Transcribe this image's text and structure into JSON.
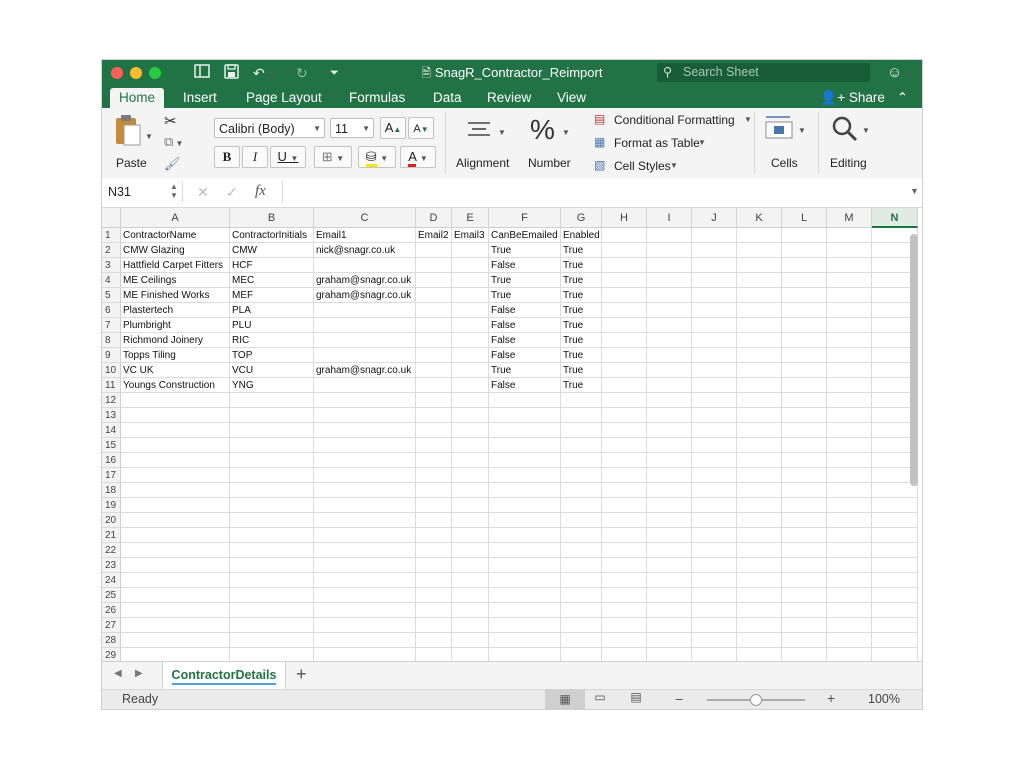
{
  "window": {
    "title": "SnagR_Contractor_Reimport",
    "search_placeholder": "Search Sheet",
    "colors": {
      "accent": "#217346",
      "close": "#fe5f57",
      "minimize": "#febc2e",
      "zoom": "#28c840"
    }
  },
  "ribbon_tabs": [
    "Home",
    "Insert",
    "Page Layout",
    "Formulas",
    "Data",
    "Review",
    "View"
  ],
  "share_label": "Share",
  "ribbon": {
    "paste_label": "Paste",
    "font_name": "Calibri (Body)",
    "font_size": "11",
    "grow_font": "A",
    "shrink_font": "A",
    "bold": "B",
    "italic": "I",
    "underline": "U",
    "font_color_letter": "A",
    "alignment_label": "Alignment",
    "number_symbol": "%",
    "number_label": "Number",
    "conditional_formatting": "Conditional Formatting",
    "format_as_table": "Format as Table",
    "cell_styles": "Cell Styles",
    "cells_label": "Cells",
    "editing_label": "Editing"
  },
  "formula_bar": {
    "name_box": "N31",
    "fx": "fx",
    "formula": ""
  },
  "grid": {
    "selected_column": "N",
    "columns": [
      "A",
      "B",
      "C",
      "D",
      "E",
      "F",
      "G",
      "H",
      "I",
      "J",
      "K",
      "L",
      "M",
      "N"
    ],
    "row_numbers": [
      "1",
      "2",
      "3",
      "4",
      "5",
      "6",
      "7",
      "8",
      "9",
      "10",
      "11",
      "12",
      "13",
      "14",
      "15",
      "16",
      "17",
      "18",
      "19",
      "20",
      "21",
      "22",
      "23",
      "24",
      "25",
      "26",
      "27",
      "28",
      "29"
    ],
    "rows": [
      [
        "ContractorName",
        "ContractorInitials",
        "Email1",
        "Email2",
        "Email3",
        "CanBeEmailed",
        "Enabled"
      ],
      [
        "CMW Glazing",
        "CMW",
        "nick@snagr.co.uk",
        "",
        "",
        "True",
        "True"
      ],
      [
        "Hattfield Carpet Fitters",
        "HCF",
        "",
        "",
        "",
        "False",
        "True"
      ],
      [
        "ME Ceilings",
        "MEC",
        "graham@snagr.co.uk",
        "",
        "",
        "True",
        "True"
      ],
      [
        "ME Finished Works",
        "MEF",
        "graham@snagr.co.uk",
        "",
        "",
        "True",
        "True"
      ],
      [
        "Plastertech",
        "PLA",
        "",
        "",
        "",
        "False",
        "True"
      ],
      [
        "Plumbright",
        "PLU",
        "",
        "",
        "",
        "False",
        "True"
      ],
      [
        "Richmond Joinery",
        "RIC",
        "",
        "",
        "",
        "False",
        "True"
      ],
      [
        "Topps Tiling",
        "TOP",
        "",
        "",
        "",
        "False",
        "True"
      ],
      [
        "VC UK",
        "VCU",
        "graham@snagr.co.uk",
        "",
        "",
        "True",
        "True"
      ],
      [
        "Youngs Construction",
        "YNG",
        "",
        "",
        "",
        "False",
        "True"
      ]
    ]
  },
  "sheet_tabs": [
    "ContractorDetails"
  ],
  "add_sheet": "+",
  "status": {
    "text": "Ready",
    "zoom": "100%",
    "zoom_out": "−",
    "zoom_in": "+",
    "zoom_level": 0.5
  }
}
